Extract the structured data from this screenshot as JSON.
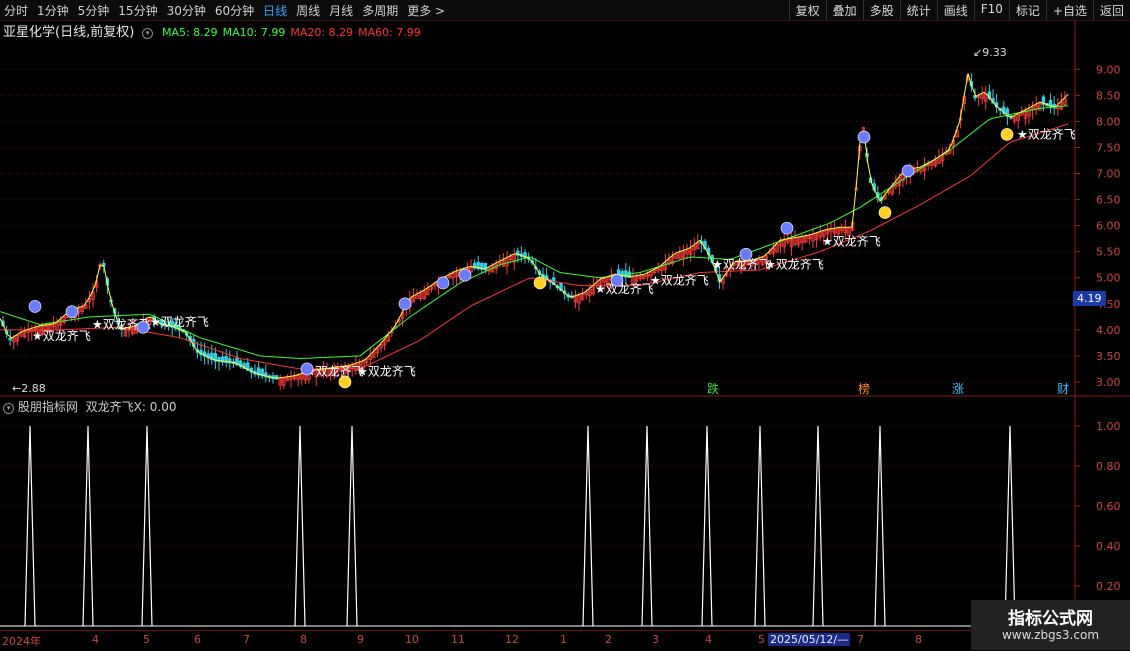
{
  "toolbar": {
    "periods": [
      "分时",
      "1分钟",
      "5分钟",
      "15分钟",
      "30分钟",
      "60分钟",
      "日线",
      "周线",
      "月线",
      "多周期",
      "更多 >"
    ],
    "active_period": "日线",
    "buttons": [
      "复权",
      "叠加",
      "多股",
      "统计",
      "画线",
      "F10",
      "标记",
      "+自选",
      "返回"
    ]
  },
  "stock": {
    "name": "亚星化学(日线,前复权)"
  },
  "ma": [
    {
      "label": "MA5: 8.29",
      "color": "#32ff32"
    },
    {
      "label": "MA10: 7.99",
      "color": "#32ff32"
    },
    {
      "label": "MA20: 8.29",
      "color": "#ff3232"
    },
    {
      "label": "MA60: 7.99",
      "color": "#ff3232"
    }
  ],
  "indicator": {
    "name": "股朋指标网",
    "formula": "双龙齐飞X: 0.00"
  },
  "current_price": "4.19",
  "date_labels": [
    "2024年",
    "4",
    "5",
    "6",
    "7",
    "8",
    "9",
    "10",
    "11",
    "12",
    "1",
    "2",
    "3",
    "4",
    "5",
    "7",
    "8"
  ],
  "date_cursor": "2025/05/12/—",
  "watermark": {
    "title": "指标公式网",
    "url": "www.zbgs3.com"
  },
  "event_labels": [
    "跌",
    "榜",
    "涨",
    "财"
  ],
  "chart_data": {
    "type": "candlestick",
    "yticks": [
      "9.00",
      "8.50",
      "8.00",
      "7.50",
      "7.00",
      "6.50",
      "6.00",
      "5.50",
      "5.00",
      "4.50",
      "4.00",
      "3.50",
      "3.00"
    ],
    "ylim": [
      2.75,
      9.6
    ],
    "high_label": "9.33",
    "low_label": "2.88",
    "signal_label": "★双龙齐飞",
    "ma_colors": {
      "ma5": "#ffffff",
      "ma10": "#ffff40",
      "ma20": "#32ff32",
      "ma60": "#ff3232"
    },
    "close_points": [
      [
        0,
        4.2
      ],
      [
        10,
        3.8
      ],
      [
        22,
        3.95
      ],
      [
        38,
        4.05
      ],
      [
        55,
        4.1
      ],
      [
        70,
        4.35
      ],
      [
        85,
        4.45
      ],
      [
        95,
        4.8
      ],
      [
        102,
        5.4
      ],
      [
        110,
        4.6
      ],
      [
        120,
        4.0
      ],
      [
        135,
        4.05
      ],
      [
        150,
        4.25
      ],
      [
        160,
        4.1
      ],
      [
        172,
        4.05
      ],
      [
        185,
        3.95
      ],
      [
        198,
        3.55
      ],
      [
        215,
        3.4
      ],
      [
        235,
        3.35
      ],
      [
        255,
        3.15
      ],
      [
        275,
        3.05
      ],
      [
        295,
        3.1
      ],
      [
        310,
        3.2
      ],
      [
        330,
        3.25
      ],
      [
        350,
        3.3
      ],
      [
        365,
        3.4
      ],
      [
        380,
        3.7
      ],
      [
        395,
        4.05
      ],
      [
        410,
        4.6
      ],
      [
        425,
        4.75
      ],
      [
        440,
        4.95
      ],
      [
        455,
        5.1
      ],
      [
        470,
        5.2
      ],
      [
        485,
        5.15
      ],
      [
        500,
        5.3
      ],
      [
        515,
        5.45
      ],
      [
        530,
        5.35
      ],
      [
        540,
        5.05
      ],
      [
        555,
        4.85
      ],
      [
        570,
        4.6
      ],
      [
        585,
        4.7
      ],
      [
        600,
        4.95
      ],
      [
        615,
        5.05
      ],
      [
        630,
        5.0
      ],
      [
        645,
        5.05
      ],
      [
        660,
        5.2
      ],
      [
        675,
        5.45
      ],
      [
        690,
        5.55
      ],
      [
        700,
        5.7
      ],
      [
        710,
        5.4
      ],
      [
        720,
        4.9
      ],
      [
        735,
        5.3
      ],
      [
        750,
        5.3
      ],
      [
        765,
        5.4
      ],
      [
        780,
        5.7
      ],
      [
        795,
        5.75
      ],
      [
        810,
        5.8
      ],
      [
        825,
        5.9
      ],
      [
        840,
        5.95
      ],
      [
        852,
        5.95
      ],
      [
        858,
        7.05
      ],
      [
        862,
        8.1
      ],
      [
        870,
        6.85
      ],
      [
        880,
        6.45
      ],
      [
        890,
        6.7
      ],
      [
        905,
        7.05
      ],
      [
        920,
        7.1
      ],
      [
        935,
        7.25
      ],
      [
        950,
        7.45
      ],
      [
        960,
        8.0
      ],
      [
        968,
        8.9
      ],
      [
        975,
        8.45
      ],
      [
        985,
        8.55
      ],
      [
        995,
        8.3
      ],
      [
        1010,
        8.05
      ],
      [
        1025,
        8.2
      ],
      [
        1040,
        8.35
      ],
      [
        1055,
        8.25
      ],
      [
        1068,
        8.5
      ]
    ],
    "ma20_points": [
      [
        0,
        4.2
      ],
      [
        40,
        3.95
      ],
      [
        90,
        4.1
      ],
      [
        150,
        4.15
      ],
      [
        200,
        3.7
      ],
      [
        260,
        3.35
      ],
      [
        300,
        3.3
      ],
      [
        360,
        3.35
      ],
      [
        410,
        4.1
      ],
      [
        460,
        4.75
      ],
      [
        500,
        5.1
      ],
      [
        530,
        5.25
      ],
      [
        560,
        4.95
      ],
      [
        600,
        4.85
      ],
      [
        640,
        4.95
      ],
      [
        690,
        5.25
      ],
      [
        730,
        5.2
      ],
      [
        780,
        5.55
      ],
      [
        830,
        5.9
      ],
      [
        860,
        6.2
      ],
      [
        900,
        6.7
      ],
      [
        950,
        7.3
      ],
      [
        990,
        7.9
      ],
      [
        1040,
        8.1
      ],
      [
        1068,
        8.15
      ]
    ],
    "ma60_points": [
      [
        0,
        4.0
      ],
      [
        60,
        4.0
      ],
      [
        120,
        4.05
      ],
      [
        180,
        3.85
      ],
      [
        240,
        3.45
      ],
      [
        300,
        3.25
      ],
      [
        360,
        3.25
      ],
      [
        420,
        3.8
      ],
      [
        470,
        4.45
      ],
      [
        530,
        5.0
      ],
      [
        580,
        4.85
      ],
      [
        640,
        4.85
      ],
      [
        700,
        5.1
      ],
      [
        760,
        5.15
      ],
      [
        820,
        5.5
      ],
      [
        870,
        5.9
      ],
      [
        920,
        6.4
      ],
      [
        970,
        6.95
      ],
      [
        1010,
        7.6
      ],
      [
        1068,
        7.95
      ]
    ],
    "signals": [
      {
        "x": 32,
        "y": 3.88
      },
      {
        "x": 92,
        "y": 4.1
      },
      {
        "x": 150,
        "y": 4.15
      },
      {
        "x": 305,
        "y": 3.2
      },
      {
        "x": 357,
        "y": 3.2
      },
      {
        "x": 595,
        "y": 4.78
      },
      {
        "x": 650,
        "y": 4.95
      },
      {
        "x": 712,
        "y": 5.25
      },
      {
        "x": 765,
        "y": 5.25
      },
      {
        "x": 822,
        "y": 5.7
      },
      {
        "x": 1017,
        "y": 7.75
      }
    ],
    "indicator_ylim": [
      0,
      1.05
    ],
    "indicator_yticks": [
      "1.00",
      "0.80",
      "0.60",
      "0.40",
      "0.20"
    ],
    "indicator_spikes": [
      30,
      88,
      147,
      300,
      352,
      588,
      647,
      707,
      760,
      818,
      880,
      1010
    ]
  }
}
